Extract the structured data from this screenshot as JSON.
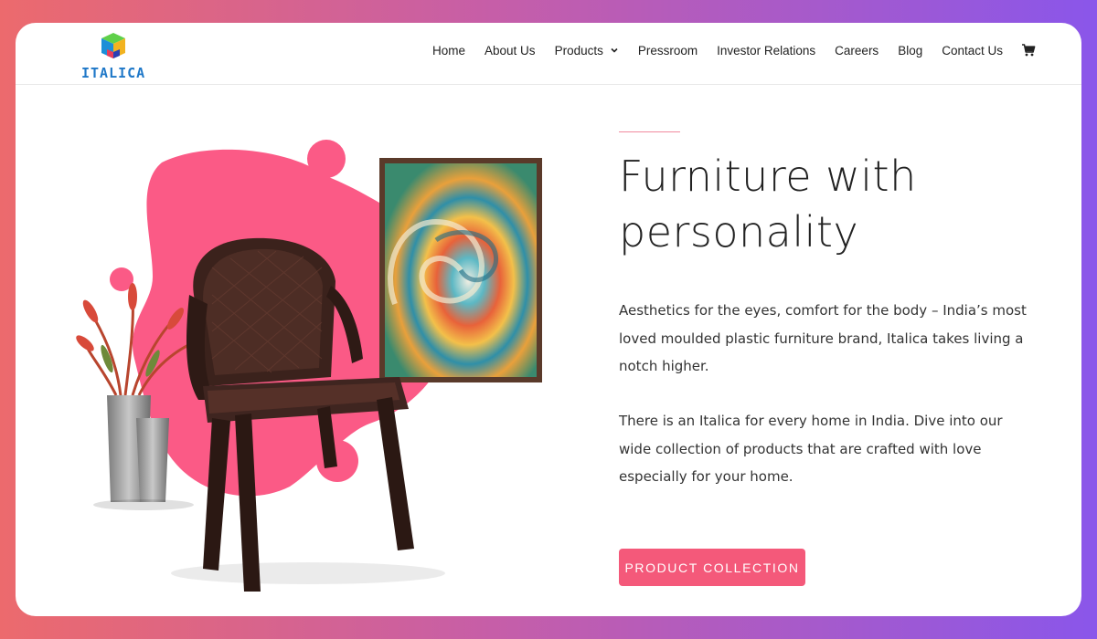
{
  "brand": {
    "name": "ITALICA",
    "colors": {
      "accent": "#f4597a",
      "logo_blue": "#1f78c8",
      "bg_start": "#ec6a6d",
      "bg_end": "#8a56ea"
    }
  },
  "nav": {
    "items": [
      {
        "label": "Home"
      },
      {
        "label": "About Us"
      },
      {
        "label": "Products",
        "has_dropdown": true
      },
      {
        "label": "Pressroom"
      },
      {
        "label": "Investor Relations"
      },
      {
        "label": "Careers"
      },
      {
        "label": "Blog"
      },
      {
        "label": "Contact Us"
      }
    ],
    "cart_icon": "shopping-cart-icon",
    "dropdown_icon": "chevron-down-icon"
  },
  "hero": {
    "title": "Furniture with personality",
    "paragraph1": "Aesthetics for the eyes, comfort for the body – India’s most loved moulded plastic furniture brand, Italica takes living a notch higher.",
    "paragraph2": "There is an Italica for every home in India. Dive into our wide collection of products that are crafted with love especially for your home.",
    "cta_label": "PRODUCT COLLECTION"
  }
}
